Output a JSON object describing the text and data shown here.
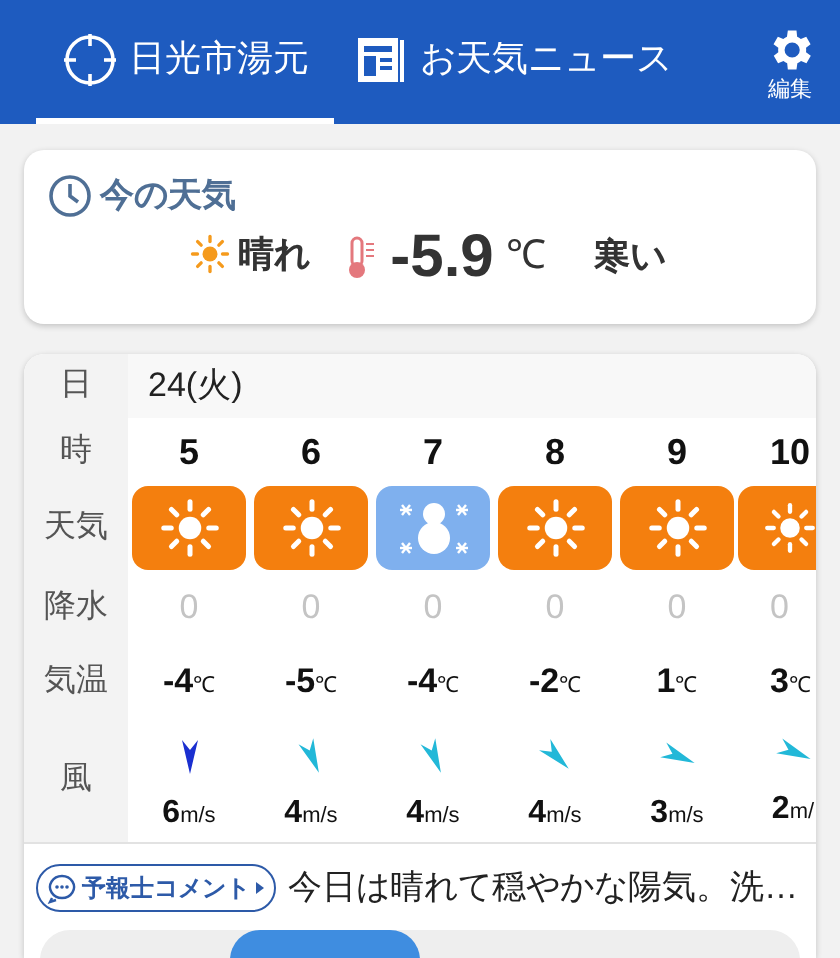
{
  "header": {
    "tabs": [
      {
        "label": "日光市湯元",
        "selected": true
      },
      {
        "label": "お天気ニュース",
        "selected": false
      }
    ],
    "settings": {
      "label": "編集"
    }
  },
  "current": {
    "title": "今の天気",
    "condition": "晴れ",
    "temperature": "-5.9",
    "unit": "℃",
    "feeling": "寒い"
  },
  "forecast": {
    "row_labels": {
      "date": "日",
      "hour": "時",
      "weather": "天気",
      "precip": "降水",
      "temp": "気温",
      "wind": "風"
    },
    "date": "24(火)",
    "hours": [
      {
        "hour": "5",
        "kind": "sunny",
        "precip": "0",
        "temp": "-4",
        "temp_unit": "℃",
        "wind": {
          "kind": "N",
          "color": "#1a2fd0",
          "speed": "6",
          "unit": "m/s"
        }
      },
      {
        "hour": "6",
        "kind": "sunny",
        "precip": "0",
        "temp": "-5",
        "temp_unit": "℃",
        "wind": {
          "kind": "NNW",
          "color": "#22b8d8",
          "speed": "4",
          "unit": "m/s"
        }
      },
      {
        "hour": "7",
        "kind": "snow",
        "precip": "0",
        "temp": "-4",
        "temp_unit": "℃",
        "wind": {
          "kind": "NNW",
          "color": "#22b8d8",
          "speed": "4",
          "unit": "m/s"
        }
      },
      {
        "hour": "8",
        "kind": "sunny",
        "precip": "0",
        "temp": "-2",
        "temp_unit": "℃",
        "wind": {
          "kind": "NW",
          "color": "#22b8d8",
          "speed": "4",
          "unit": "m/s"
        }
      },
      {
        "hour": "9",
        "kind": "sunny",
        "precip": "0",
        "temp": "1",
        "temp_unit": "℃",
        "wind": {
          "kind": "WNW",
          "color": "#22b8d8",
          "speed": "3",
          "unit": "m/s"
        }
      },
      {
        "hour": "10",
        "kind": "sunny",
        "precip": "0",
        "temp": "3",
        "temp_unit": "℃",
        "wind": {
          "kind": "WNW",
          "color": "#22b8d8",
          "speed": "2",
          "unit": "m/"
        }
      }
    ]
  },
  "comment": {
    "button": "予報士コメント",
    "text": "今日は晴れて穏やかな陽気。洗…"
  }
}
